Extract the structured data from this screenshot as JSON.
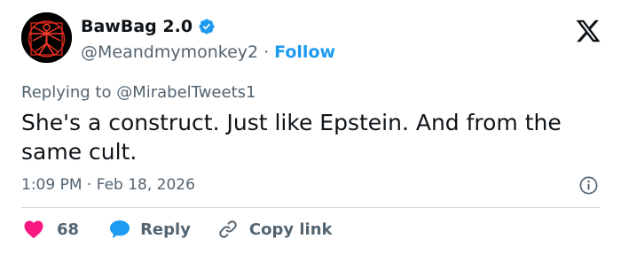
{
  "author": {
    "display_name": "BawBag 2.0",
    "handle": "@Meandmymonkey2",
    "separator": "·",
    "follow_label": "Follow",
    "avatar_icon": "vitruvian-man-icon",
    "verified_color": "#1d9bf0"
  },
  "replying": {
    "prefix": "Replying to",
    "to_handle": "@MirabelTweets1"
  },
  "tweet": {
    "text": "She's a construct. Just like Epstein. And from the same cult.",
    "time": "1:09 PM",
    "separator": "·",
    "date": "Feb 18, 2026"
  },
  "actions": {
    "like_count": "68",
    "reply_label": "Reply",
    "copy_link_label": "Copy link"
  },
  "colors": {
    "accent": "#1d9bf0",
    "like": "#f91880",
    "text": "#0f1419",
    "muted": "#536471"
  }
}
